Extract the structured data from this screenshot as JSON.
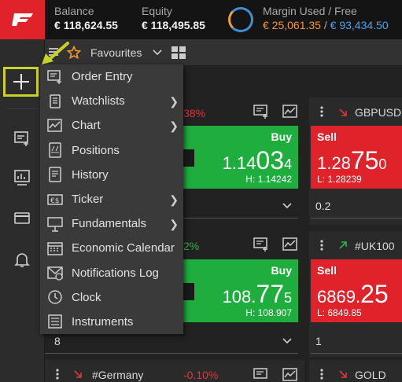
{
  "account": {
    "balance_label": "Balance",
    "balance_value": "€ 118,624.55",
    "equity_label": "Equity",
    "equity_value": "€ 118,495.85",
    "margin_label": "Margin Used / Free",
    "margin_used": "€ 25,061.35",
    "margin_sep": " / ",
    "margin_free": "€ 93,434.50"
  },
  "toolbar": {
    "favourites_label": "Favourites",
    "star_icon": "star-icon",
    "grid_icon": "grid-icon"
  },
  "menu": {
    "items": [
      {
        "label": "Order Entry",
        "icon": "order-entry-icon",
        "submenu": false
      },
      {
        "label": "Watchlists",
        "icon": "watchlists-icon",
        "submenu": true
      },
      {
        "label": "Chart",
        "icon": "chart-icon",
        "submenu": true
      },
      {
        "label": "Positions",
        "icon": "positions-icon",
        "submenu": false
      },
      {
        "label": "History",
        "icon": "history-icon",
        "submenu": false
      },
      {
        "label": "Ticker",
        "icon": "ticker-icon",
        "submenu": true
      },
      {
        "label": "Fundamentals",
        "icon": "fundamentals-icon",
        "submenu": true
      },
      {
        "label": "Economic Calendar",
        "icon": "calendar-icon",
        "submenu": false
      },
      {
        "label": "Notifications Log",
        "icon": "notifications-icon",
        "submenu": false
      },
      {
        "label": "Clock",
        "icon": "clock-icon",
        "submenu": false
      },
      {
        "label": "Instruments",
        "icon": "instruments-icon",
        "submenu": false
      }
    ]
  },
  "tiles": {
    "t1": {
      "pct": "38%",
      "buy_label": "Buy",
      "buy_price_small": "1.14",
      "buy_price_big": "03",
      "buy_price_tail": "4",
      "high": "H: 1.14242",
      "qty": ""
    },
    "t2": {
      "symbol": "GBPUSD",
      "sell_label": "Sell",
      "sell_price_small": "1.28",
      "sell_price_big": "75",
      "sell_price_tail": "0",
      "low": "L: 1.28239",
      "qty": "0.2"
    },
    "t3": {
      "pct": "2%",
      "buy_label": "Buy",
      "buy_price_small": "108.",
      "buy_price_big": "77",
      "buy_price_tail": "5",
      "high": "H: 108.907",
      "qty": "8"
    },
    "t4": {
      "symbol": "#UK100",
      "sell_label": "Sell",
      "sell_price_small": "6869.",
      "sell_price_big": "25",
      "sell_price_tail": "",
      "low": "L: 6849.85",
      "qty": "1"
    },
    "t5": {
      "symbol": "#Germany",
      "pct": "-0.10%"
    },
    "t6": {
      "symbol": "GOLD"
    }
  },
  "colors": {
    "accent_red": "#e0232b",
    "buy_green": "#1fae3e",
    "highlight_yellow": "#c8d22b"
  }
}
